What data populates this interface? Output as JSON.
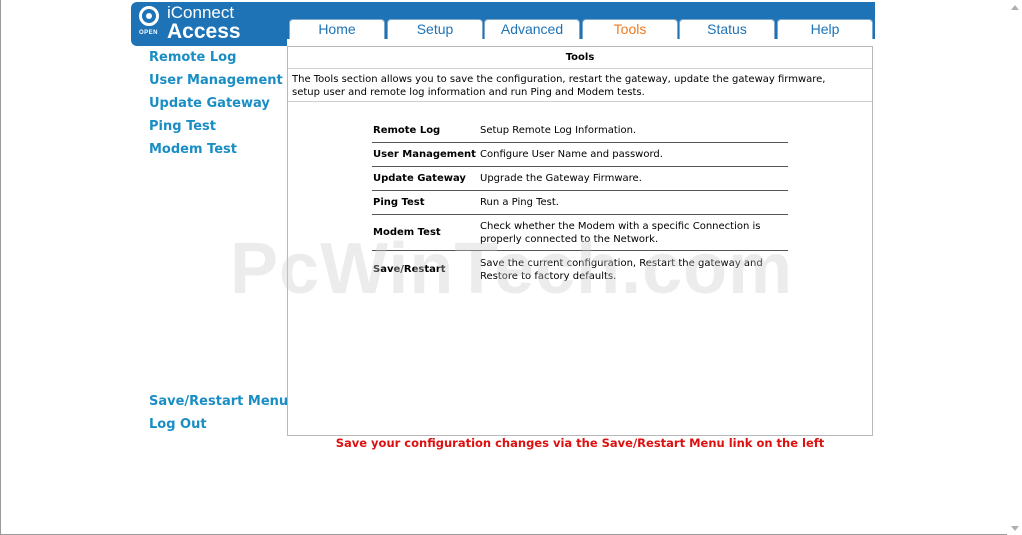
{
  "logo": {
    "top": "iConnect",
    "bottom": "Access",
    "badge": "OPEN"
  },
  "tabs": [
    {
      "label": "Home"
    },
    {
      "label": "Setup"
    },
    {
      "label": "Advanced"
    },
    {
      "label": "Tools",
      "active": true
    },
    {
      "label": "Status"
    },
    {
      "label": "Help"
    }
  ],
  "sidebar": {
    "items": [
      "Remote Log",
      "User Management",
      "Update Gateway",
      "Ping Test",
      "Modem Test"
    ],
    "bottom_items": [
      "Save/Restart Menu",
      "Log Out"
    ]
  },
  "panel": {
    "title": "Tools",
    "description": "The Tools section allows you to save the configuration, restart the gateway, update the gateway firmware, setup user and remote log information and run Ping and Modem tests.",
    "rows": [
      {
        "name": "Remote Log",
        "desc": "Setup Remote Log Information."
      },
      {
        "name": "User Management",
        "desc": "Configure User Name and password."
      },
      {
        "name": "Update Gateway",
        "desc": "Upgrade the Gateway Firmware."
      },
      {
        "name": "Ping Test",
        "desc": "Run a Ping Test."
      },
      {
        "name": "Modem Test",
        "desc": "Check whether the Modem with a specific Connection is properly connected to the Network."
      },
      {
        "name": "Save/Restart",
        "desc": "Save the current configuration, Restart the gateway and Restore to factory defaults."
      }
    ]
  },
  "notice": "Save your configuration changes via the Save/Restart Menu link on the left",
  "watermark": "PcWinTech.com",
  "colors": {
    "brand": "#1e73b6",
    "active_tab": "#f07a1e",
    "link": "#1a8ec4",
    "notice": "#dd1010"
  }
}
